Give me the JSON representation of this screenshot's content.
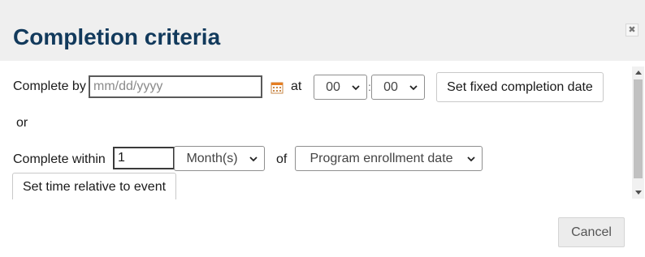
{
  "dialog": {
    "title": "Completion criteria",
    "close_icon": "close-icon"
  },
  "fixed_date": {
    "label": "Complete by",
    "date_placeholder": "mm/dd/yyyy",
    "date_value": "",
    "calendar_icon": "calendar-icon",
    "at_label": "at",
    "hour": "00",
    "minute": "00",
    "time_separator": ":",
    "set_button": "Set fixed completion date"
  },
  "or_label": "or",
  "relative": {
    "label": "Complete within",
    "amount": "1",
    "unit": "Month(s)",
    "of_label": "of",
    "event": "Program enrollment date",
    "set_button": "Set time relative to event"
  },
  "footer": {
    "cancel_label": "Cancel"
  },
  "colors": {
    "title": "#123a5c",
    "header_bg": "#efefef",
    "calendar_accent": "#e67e22"
  }
}
